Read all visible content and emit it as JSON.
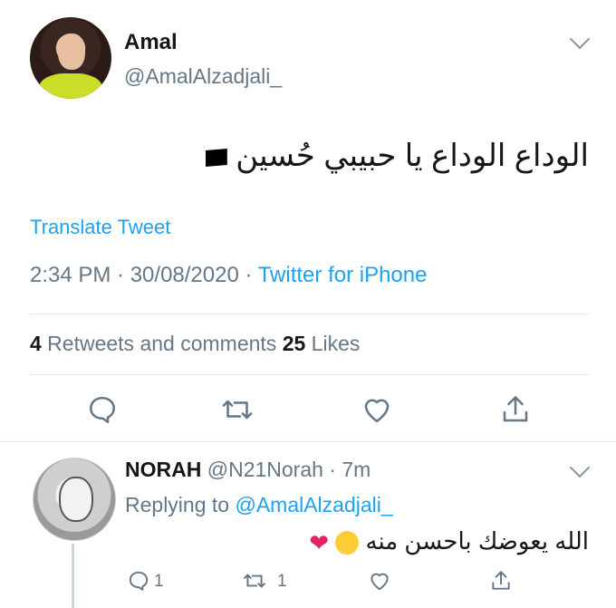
{
  "tweet": {
    "author_name": "Amal",
    "author_handle": "@AmalAlzadjali_",
    "text": "الوداع الوداع يا حبيبي حُسين",
    "translate_label": "Translate Tweet",
    "timestamp": "2:34 PM · 30/08/2020 · ",
    "source": "Twitter for iPhone",
    "retweets_count": "4",
    "retweets_label": " Retweets and comments ",
    "likes_count": "25",
    "likes_label": " Likes"
  },
  "reply": {
    "author_name": "NORAH",
    "author_handle": "@N21Norah",
    "time": " · 7m",
    "replying_prefix": "Replying to ",
    "replying_handle": "@AmalAlzadjali_",
    "text": "الله يعوضك باحسن منه",
    "reply_count": "1",
    "retweet_count": "1"
  },
  "colors": {
    "accent": "#1da1f2",
    "muted": "#657786",
    "divider": "#e1e8ed",
    "heart": "#e0245e"
  },
  "icons": [
    "reply-icon",
    "retweet-icon",
    "like-icon",
    "share-icon",
    "chevron-down-icon",
    "black-flag-icon",
    "pleading-face-emoji",
    "red-heart-emoji"
  ]
}
